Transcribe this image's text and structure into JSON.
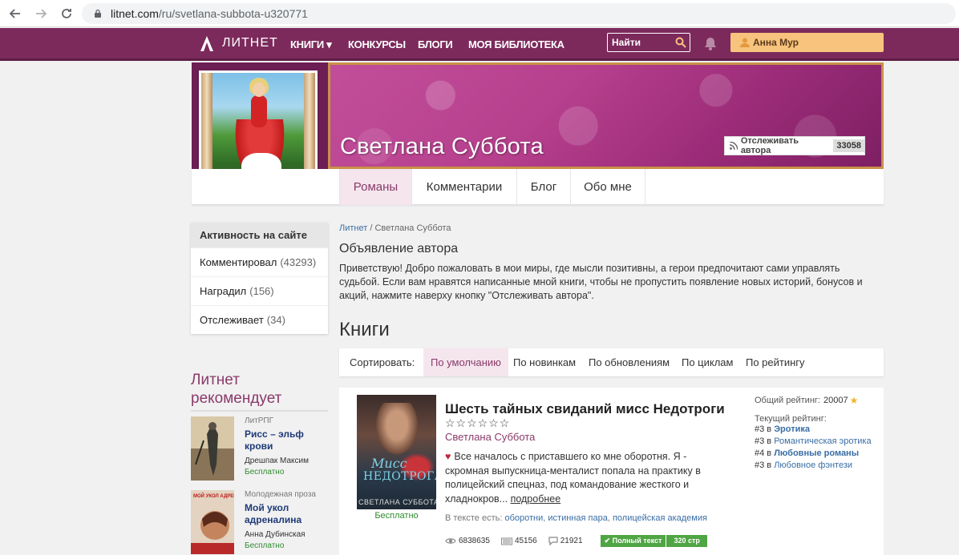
{
  "browser": {
    "url_host": "litnet.com",
    "url_path": "/ru/svetlana-subbota-u320771"
  },
  "site_nav": {
    "logo_text": "ЛИТНЕТ",
    "links": [
      "КНИГИ ▾",
      "КОНКУРСЫ",
      "БЛОГИ",
      "МОЯ БИБЛИОТЕКА"
    ],
    "search_placeholder": "Найти",
    "user_name": "Анна Мур"
  },
  "colors": {
    "nav_bg": "#7c2a5c",
    "accent": "#8a3a6a",
    "user_btn": "#f8c37c",
    "free_green": "#2e8a2e",
    "fulltext_green": "#4fa543"
  },
  "author": {
    "name": "Светлана Суббота",
    "follow_label": "Отслеживать автора",
    "follow_count": "33058"
  },
  "tabs": [
    {
      "label": "Романы",
      "active": true
    },
    {
      "label": "Комментарии",
      "active": false
    },
    {
      "label": "Блог",
      "active": false
    },
    {
      "label": "Обо мне",
      "active": false
    }
  ],
  "activity": {
    "title": "Активность на сайте",
    "items": [
      {
        "label": "Комментировал",
        "count": "(43293)"
      },
      {
        "label": "Наградил",
        "count": "(156)"
      },
      {
        "label": "Отслеживает",
        "count": "(34)"
      }
    ]
  },
  "recommend": {
    "title": "Литнет рекомендует",
    "items": [
      {
        "genre": "ЛитРПГ",
        "title": "Рисс – эльф крови",
        "author": "Дрешпак Максим",
        "price": "Бесплатно"
      },
      {
        "genre": "Молодежная проза",
        "title": "Мой укол адреналина",
        "author": "Анна Дубинская",
        "price": "Бесплатно"
      }
    ],
    "cover2_text": "МОЙ УКОЛ АДРЕНАЛИНА"
  },
  "breadcrumb": {
    "root": "Литнет",
    "sep": "/",
    "current": "Светлана Суббота"
  },
  "announcement": {
    "title": "Объявление автора",
    "text": "Приветствую! Добро пожаловать в мои миры, где мысли позитивны, а герои предпочитают сами управлять судьбой. Если вам нравятся написанные мной книги, чтобы не пропустить появление новых историй, бонусов и акций, нажмите наверху кнопку \"Отслеживать автора\"."
  },
  "books": {
    "title": "Книги",
    "sort_label": "Сортировать:",
    "sort_options": [
      {
        "label": "По умолчанию",
        "active": true
      },
      {
        "label": "По новинкам",
        "active": false
      },
      {
        "label": "По обновлениям",
        "active": false
      },
      {
        "label": "По циклам",
        "active": false
      },
      {
        "label": "По рейтингу",
        "active": false
      }
    ],
    "items": [
      {
        "title": "Шесть тайных свиданий мисс Недотроги",
        "stars": "☆☆☆☆☆☆",
        "author": "Светлана Суббота",
        "cover_title_1": "Мисс",
        "cover_title_2": "НЕДОТРОГА",
        "cover_author": "СВЕТЛАНА СУББОТА",
        "price": "Бесплатно",
        "description": "Все началось с приставшего ко мне оборотня. Я - скромная выпускница-менталист попала на практику в полицейский спецназ, под командование жесткого и хладнокров...",
        "more": "подробнее",
        "tags_label": "В тексте есть:",
        "tags": [
          "оборотни",
          "истинная пара",
          "полицейская академия"
        ],
        "views": "6838635",
        "library": "45156",
        "comments": "21921",
        "fulltext_label": "Полный текст",
        "pages": "320 стр",
        "overall_label": "Общий рейтинг:",
        "overall_value": "20007",
        "current_label": "Текущий рейтинг:",
        "ranks": [
          {
            "place": "#3 в",
            "genre": "Эротика"
          },
          {
            "place": "#3 в",
            "genre": "Романтическая эротика"
          },
          {
            "place": "#4 в",
            "genre": "Любовные романы"
          },
          {
            "place": "#3 в",
            "genre": "Любовное фэнтези"
          }
        ]
      }
    ]
  }
}
